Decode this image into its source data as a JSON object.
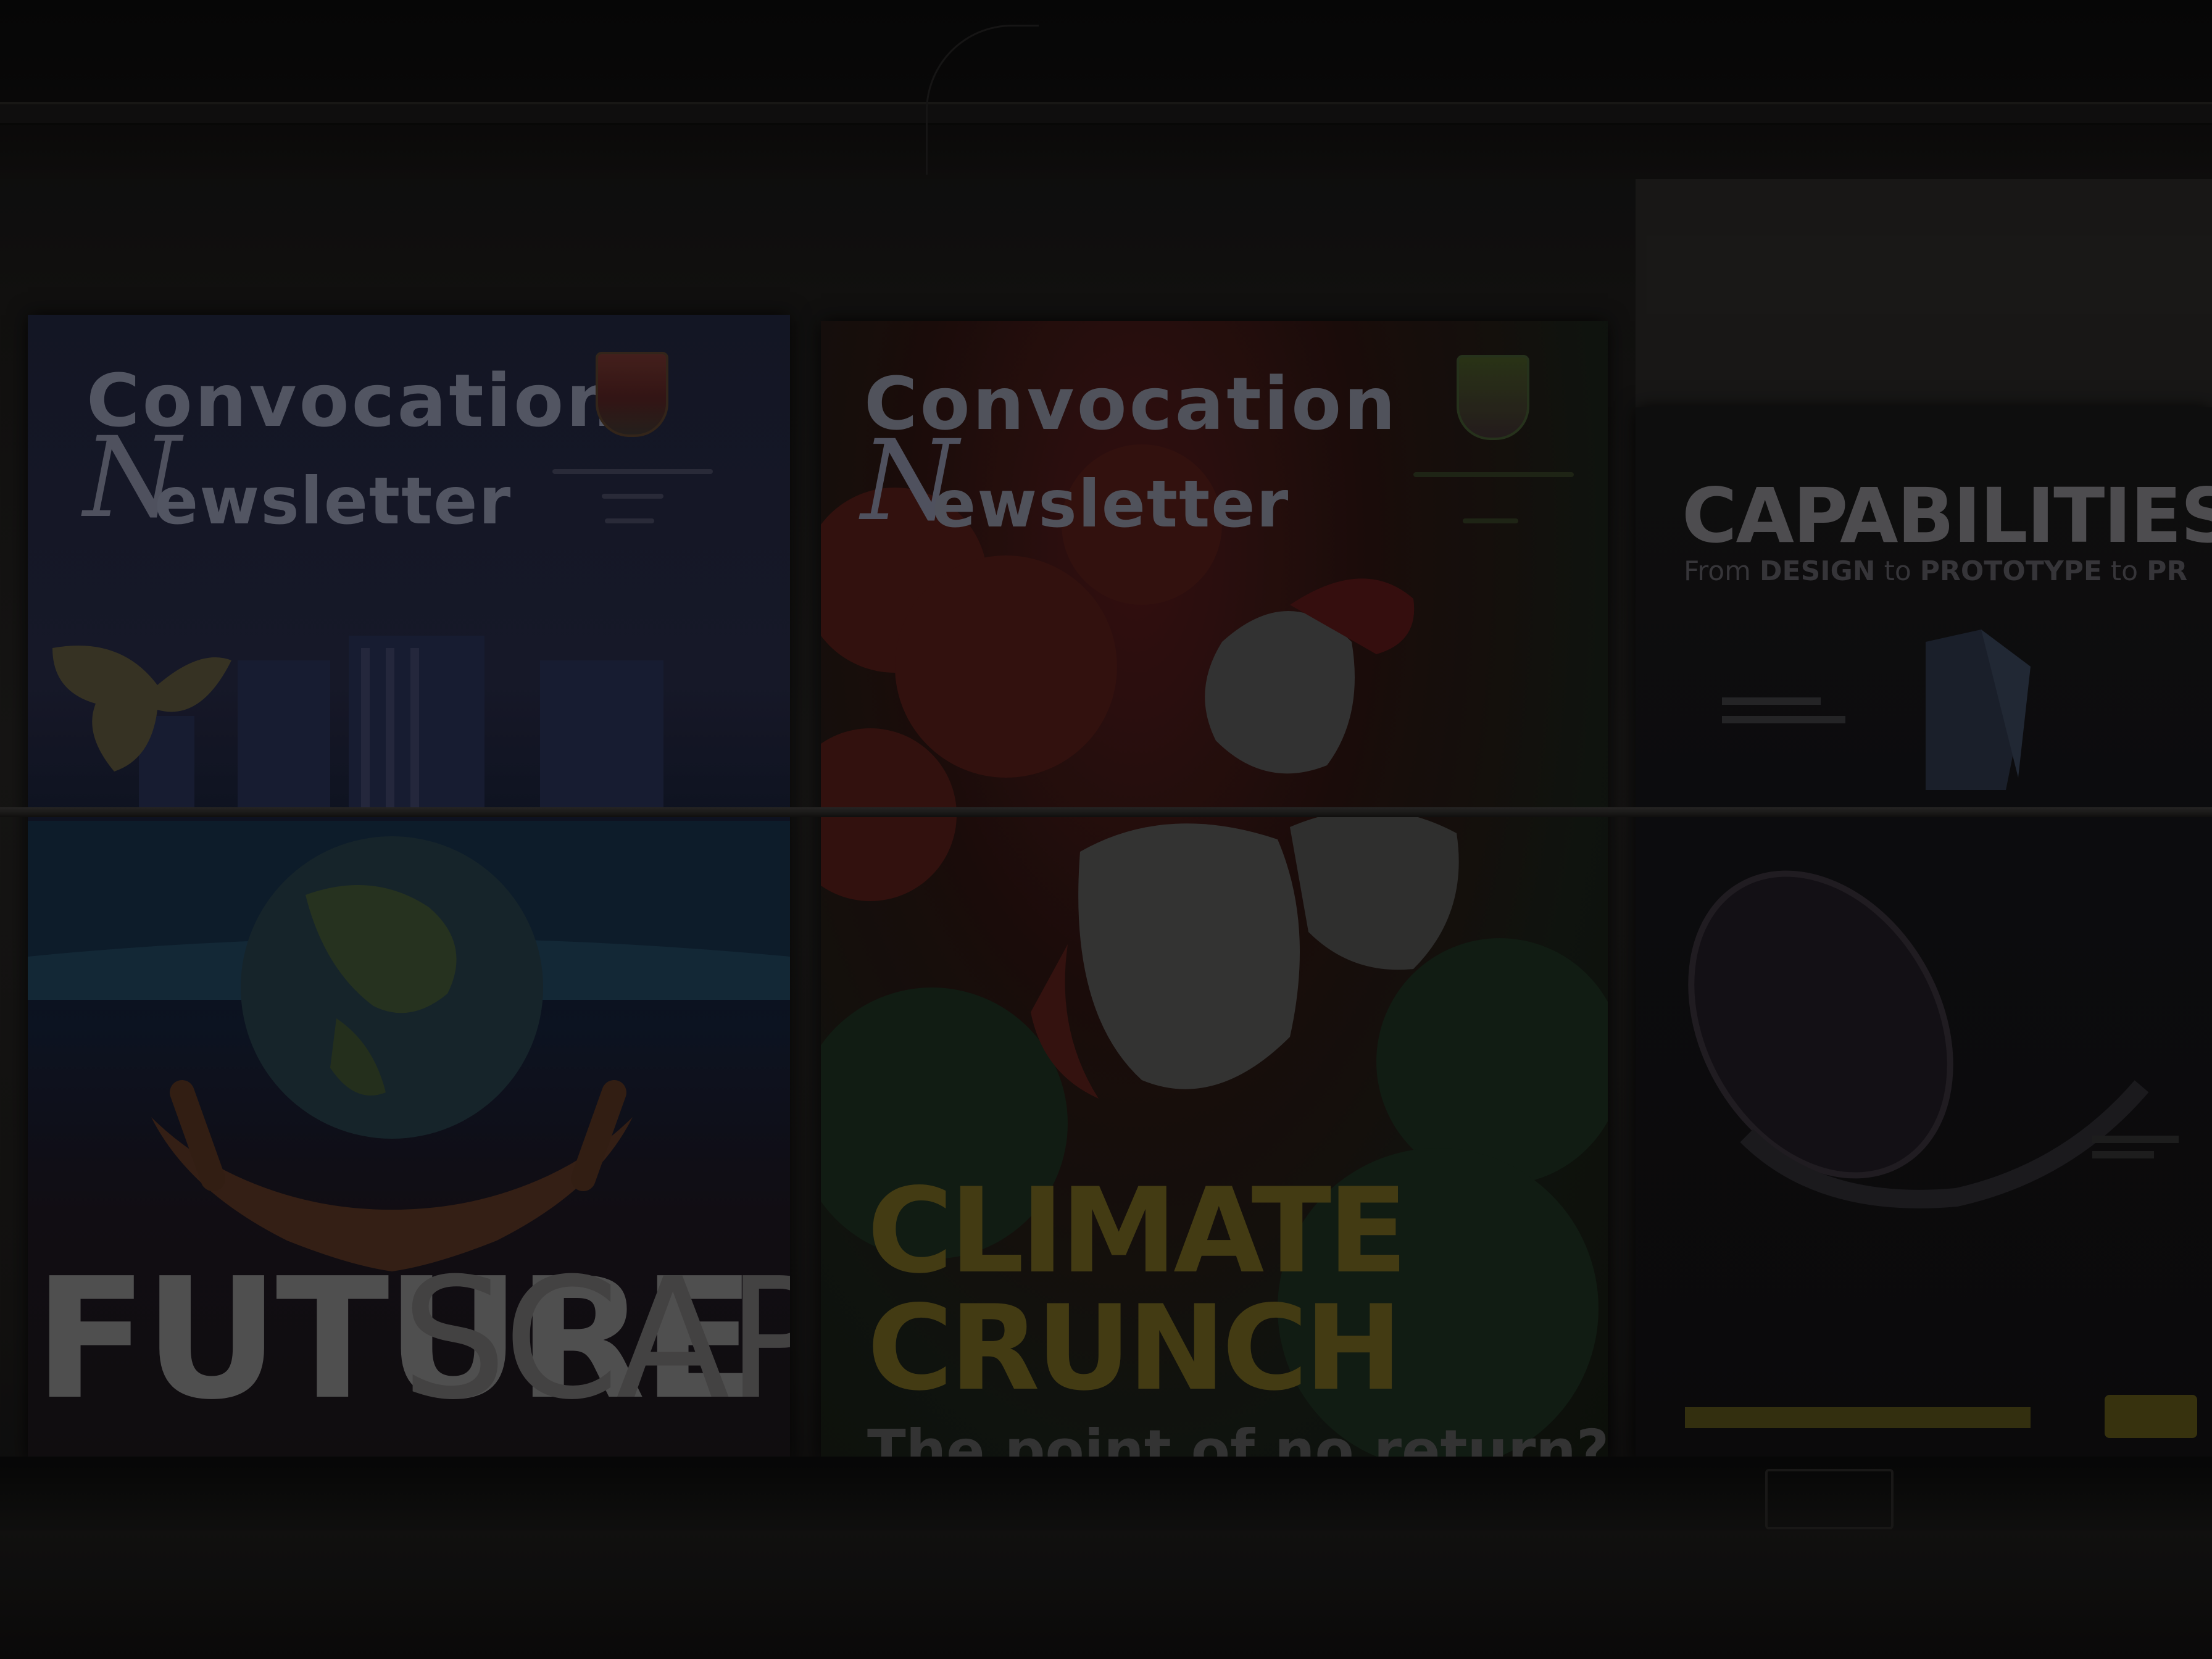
{
  "posters": [
    {
      "masthead_top": "Convocation",
      "masthead_script_initial": "N",
      "masthead_bottom": "ewsletter",
      "headline_bold": "FUTURE",
      "headline_light": "SCAPE"
    },
    {
      "masthead_top": "Convocation",
      "masthead_script_initial": "N",
      "masthead_bottom": "ewsletter",
      "headline_line1": "CLIMATE",
      "headline_line2": "CRUNCH",
      "tagline": "The point of no return?"
    },
    {
      "title": "CAPABILITIES G",
      "subtitle_parts": [
        "From",
        "DESIGN",
        "to",
        "PROTOTYPE",
        "to",
        "PR"
      ]
    }
  ],
  "colors": {
    "masthead": "#5e6170",
    "futurescape": "#5b5a5a",
    "climate_crunch": "#4d4416",
    "capabilities": "#58575a",
    "gold_accent": "#3f3a10"
  },
  "icons": [
    "globe-icon",
    "hands-icon",
    "butterfly-icon",
    "university-crest-icon"
  ]
}
